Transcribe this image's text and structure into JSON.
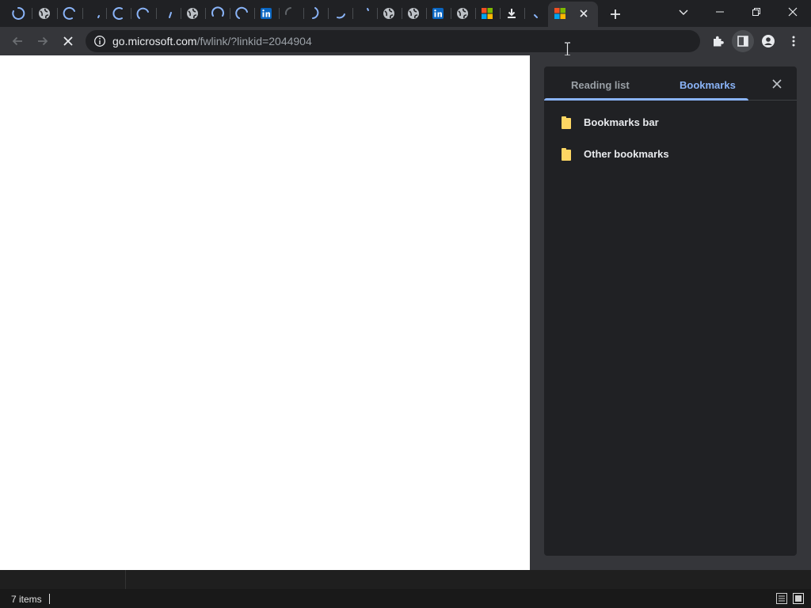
{
  "browser": {
    "address": {
      "host": "go.microsoft.com",
      "path": "/fwlink/?linkid=2044904"
    }
  },
  "side_panel": {
    "tabs": [
      {
        "label": "Reading list"
      },
      {
        "label": "Bookmarks"
      }
    ],
    "active_tab": "Bookmarks",
    "bookmarks": [
      {
        "label": "Bookmarks bar",
        "icon": "folder-icon"
      },
      {
        "label": "Other bookmarks",
        "icon": "folder-icon"
      }
    ]
  },
  "status_bar": {
    "items_text": "7 items"
  },
  "colors": {
    "accent": "#8ab4f8",
    "folder": "#fdd663",
    "panel_bg": "#202124",
    "toolbar_bg": "#35363a"
  }
}
